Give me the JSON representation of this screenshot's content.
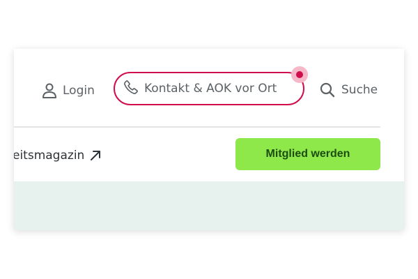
{
  "header": {
    "login_label": "Login",
    "contact_label": "Kontakt & AOK vor Ort",
    "search_label": "Suche"
  },
  "subnav": {
    "magazin_label": "eitsmagazin",
    "cta_label": "Mitglied werden"
  },
  "icons": {
    "login": "person-icon",
    "contact": "phone-icon",
    "search": "search-icon",
    "magazin": "external-arrow-icon"
  },
  "colors": {
    "accent": "#d10e4c",
    "cta_background": "#8ee84a",
    "cta_text": "#1d4d12",
    "band": "#e7f2ef"
  }
}
